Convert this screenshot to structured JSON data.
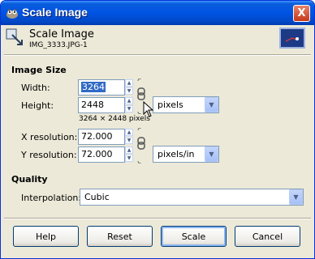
{
  "window": {
    "title": "Scale Image",
    "close_label": "X"
  },
  "header": {
    "title": "Scale Image",
    "subtitle": "IMG_3333.JPG-1"
  },
  "image_size": {
    "section_label": "Image Size",
    "width_label": "Width:",
    "width_value": "3264",
    "height_label": "Height:",
    "height_value": "2448",
    "unit_value": "pixels",
    "dimensions_note": "3264 × 2448 pixels",
    "x_res_label": "X resolution:",
    "x_res_value": "72.000",
    "y_res_label": "Y resolution:",
    "y_res_value": "72.000",
    "res_unit_value": "pixels/in"
  },
  "quality": {
    "section_label": "Quality",
    "interp_label": "Interpolation:",
    "interp_value": "Cubic"
  },
  "buttons": {
    "help": "Help",
    "reset": "Reset",
    "scale": "Scale",
    "cancel": "Cancel"
  },
  "icons": {
    "app": "gimp-icon",
    "header": "scale-image-icon",
    "chain": "chain-link-icon",
    "spin_up": "spin-up-icon",
    "spin_down": "spin-down-icon",
    "dropdown": "chevron-down-icon"
  },
  "colors": {
    "titlebar": "#0054e3",
    "dialog_bg": "#ece9d8",
    "selection": "#316ac5"
  }
}
